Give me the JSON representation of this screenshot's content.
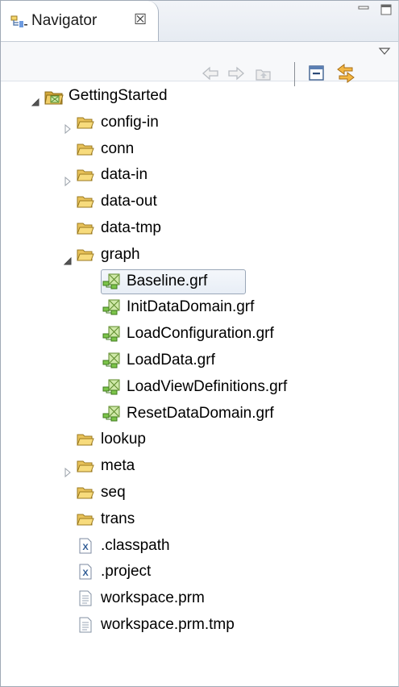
{
  "view": {
    "title": "Navigator",
    "close_glyph": "☒",
    "accent": "#5a8fd0"
  },
  "toolbar": {
    "buttons": [
      "back-icon",
      "forward-icon",
      "up-icon",
      "collapse-all-icon",
      "link-with-editor-icon",
      "view-menu-icon"
    ]
  },
  "tree": {
    "project": {
      "label": "GettingStarted",
      "expanded": true,
      "icon": "project-icon"
    },
    "items": [
      {
        "label": "config-in",
        "type": "folder",
        "expandable": true,
        "expanded": false
      },
      {
        "label": "conn",
        "type": "folder",
        "expandable": false
      },
      {
        "label": "data-in",
        "type": "folder",
        "expandable": true,
        "expanded": false
      },
      {
        "label": "data-out",
        "type": "folder",
        "expandable": false
      },
      {
        "label": "data-tmp",
        "type": "folder",
        "expandable": false
      },
      {
        "label": "graph",
        "type": "folder",
        "expandable": true,
        "expanded": true,
        "children": [
          {
            "label": "Baseline.grf",
            "type": "graph",
            "selected": true
          },
          {
            "label": "InitDataDomain.grf",
            "type": "graph"
          },
          {
            "label": "LoadConfiguration.grf",
            "type": "graph"
          },
          {
            "label": "LoadData.grf",
            "type": "graph"
          },
          {
            "label": "LoadViewDefinitions.grf",
            "type": "graph"
          },
          {
            "label": "ResetDataDomain.grf",
            "type": "graph"
          }
        ]
      },
      {
        "label": "lookup",
        "type": "folder",
        "expandable": false
      },
      {
        "label": "meta",
        "type": "folder",
        "expandable": true,
        "expanded": false
      },
      {
        "label": "seq",
        "type": "folder",
        "expandable": false
      },
      {
        "label": "trans",
        "type": "folder",
        "expandable": false
      },
      {
        "label": ".classpath",
        "type": "xml"
      },
      {
        "label": ".project",
        "type": "xml"
      },
      {
        "label": "workspace.prm",
        "type": "text"
      },
      {
        "label": "workspace.prm.tmp",
        "type": "text"
      }
    ]
  }
}
